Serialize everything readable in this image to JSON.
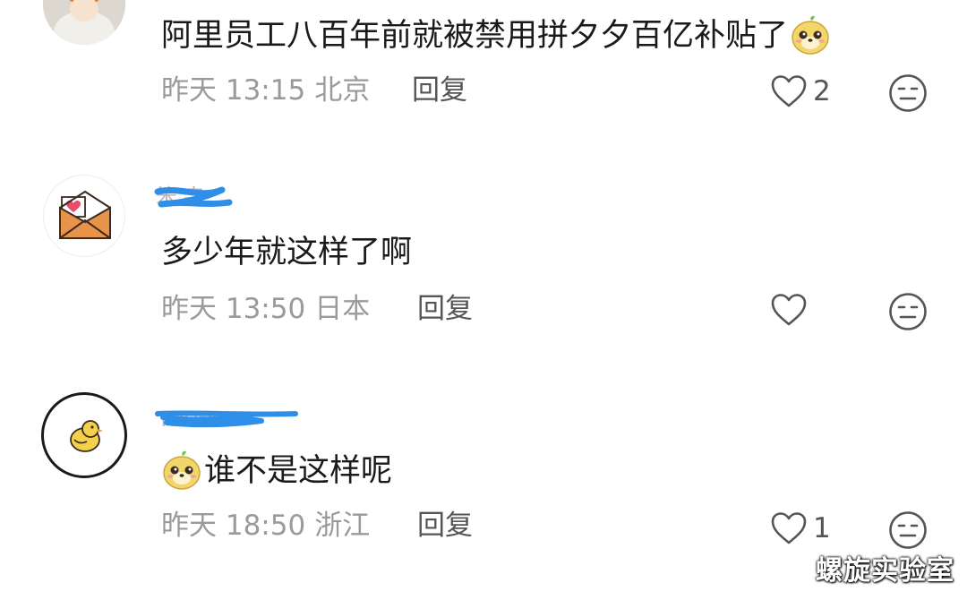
{
  "comments": [
    {
      "avatar": "photo-avatar",
      "username": "",
      "text": "阿里员工八百年前就被禁用拼夕夕百亿补贴了",
      "emoji": "dog-face-emoji",
      "time": "昨天 13:15",
      "location": "北京",
      "reply_label": "回复",
      "likes": "2",
      "react_icon": "expressionless-face-icon"
    },
    {
      "avatar": "envelope-heart-avatar",
      "username": "",
      "text": "多少年就这样了啊",
      "emoji": "",
      "time": "昨天 13:50",
      "location": "日本",
      "reply_label": "回复",
      "likes": "",
      "react_icon": "expressionless-face-icon"
    },
    {
      "avatar": "chick-avatar",
      "username": "",
      "text": "谁不是这样呢",
      "emoji": "dog-face-emoji",
      "time": "昨天 18:50",
      "location": "浙江",
      "reply_label": "回复",
      "likes": "1",
      "react_icon": "expressionless-face-icon"
    }
  ],
  "watermark": "螺旋实验室",
  "colors": {
    "text": "#1a1a1a",
    "meta": "#9a9a9a",
    "action": "#555555",
    "redaction": "#2f8fe8",
    "envelope": "#e8934a"
  }
}
